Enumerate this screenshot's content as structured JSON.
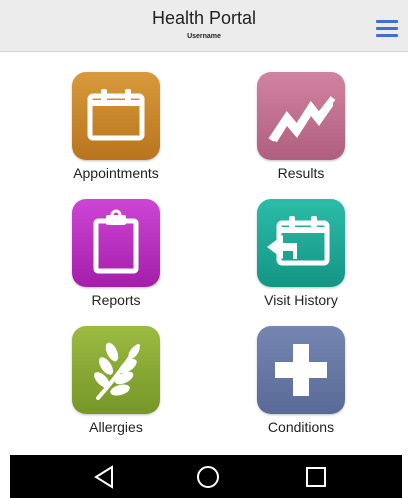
{
  "header": {
    "title": "Health Portal",
    "subtitle": "Username",
    "menu_icon": "hamburger-menu-icon"
  },
  "tiles": [
    {
      "label": "Appointments",
      "icon": "calendar-icon",
      "color": "#c98a2b"
    },
    {
      "label": "Results",
      "icon": "trend-chart-icon",
      "color": "#c0708e"
    },
    {
      "label": "Reports",
      "icon": "clipboard-icon",
      "color": "#bb2fc2"
    },
    {
      "label": "Visit History",
      "icon": "calendar-back-icon",
      "color": "#1faa98"
    },
    {
      "label": "Allergies",
      "icon": "wheat-icon",
      "color": "#8aab33"
    },
    {
      "label": "Conditions",
      "icon": "medical-cross-icon",
      "color": "#6677a6"
    }
  ],
  "navbar": {
    "back_icon": "back-triangle-icon",
    "home_icon": "home-circle-icon",
    "recents_icon": "recents-square-icon"
  }
}
